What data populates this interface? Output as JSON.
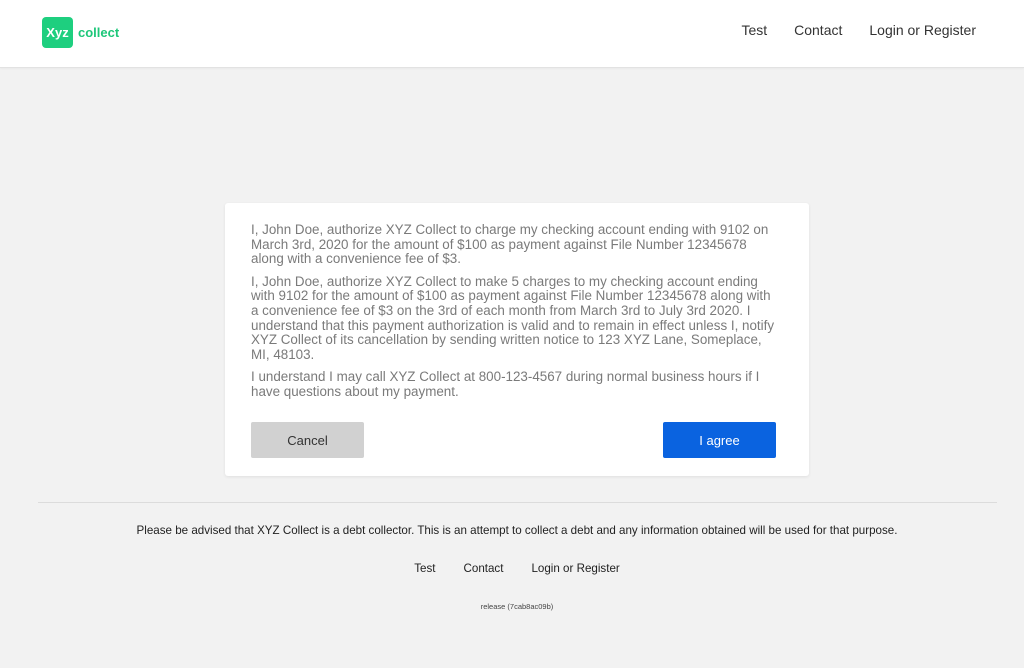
{
  "header": {
    "logo_badge": "Xyz",
    "logo_text": "collect",
    "nav": [
      "Test",
      "Contact",
      "Login or Register"
    ]
  },
  "authorization": {
    "paragraphs": [
      "I, John Doe, authorize XYZ Collect to charge my checking account ending with 9102 on March 3rd, 2020 for the amount of $100 as payment against File Number 12345678 along with a convenience fee of $3.",
      "I, John Doe, authorize XYZ Collect to make 5 charges to my checking account ending with 9102 for the amount of $100 as payment against File Number 12345678 along with a convenience fee of $3 on the 3rd of each month from March 3rd to July 3rd 2020. I understand that this payment authorization is valid and to remain in effect unless I, notify XYZ Collect of its cancellation by sending written notice to 123 XYZ Lane, Someplace, MI, 48103.",
      "I understand I may call XYZ Collect at 800-123-4567 during normal business hours if I have questions about my payment."
    ],
    "cancel_label": "Cancel",
    "agree_label": "I agree"
  },
  "footer": {
    "disclaimer": "Please be advised that XYZ Collect is a debt collector. This is an attempt to collect a debt and any information obtained will be used for that purpose.",
    "nav": [
      "Test",
      "Contact",
      "Login or Register"
    ],
    "release": "release (7cab8ac09b)"
  },
  "colors": {
    "brand": "#1ecf7f",
    "primary_button": "#0a63e0",
    "secondary_button": "#d1d1d1"
  }
}
